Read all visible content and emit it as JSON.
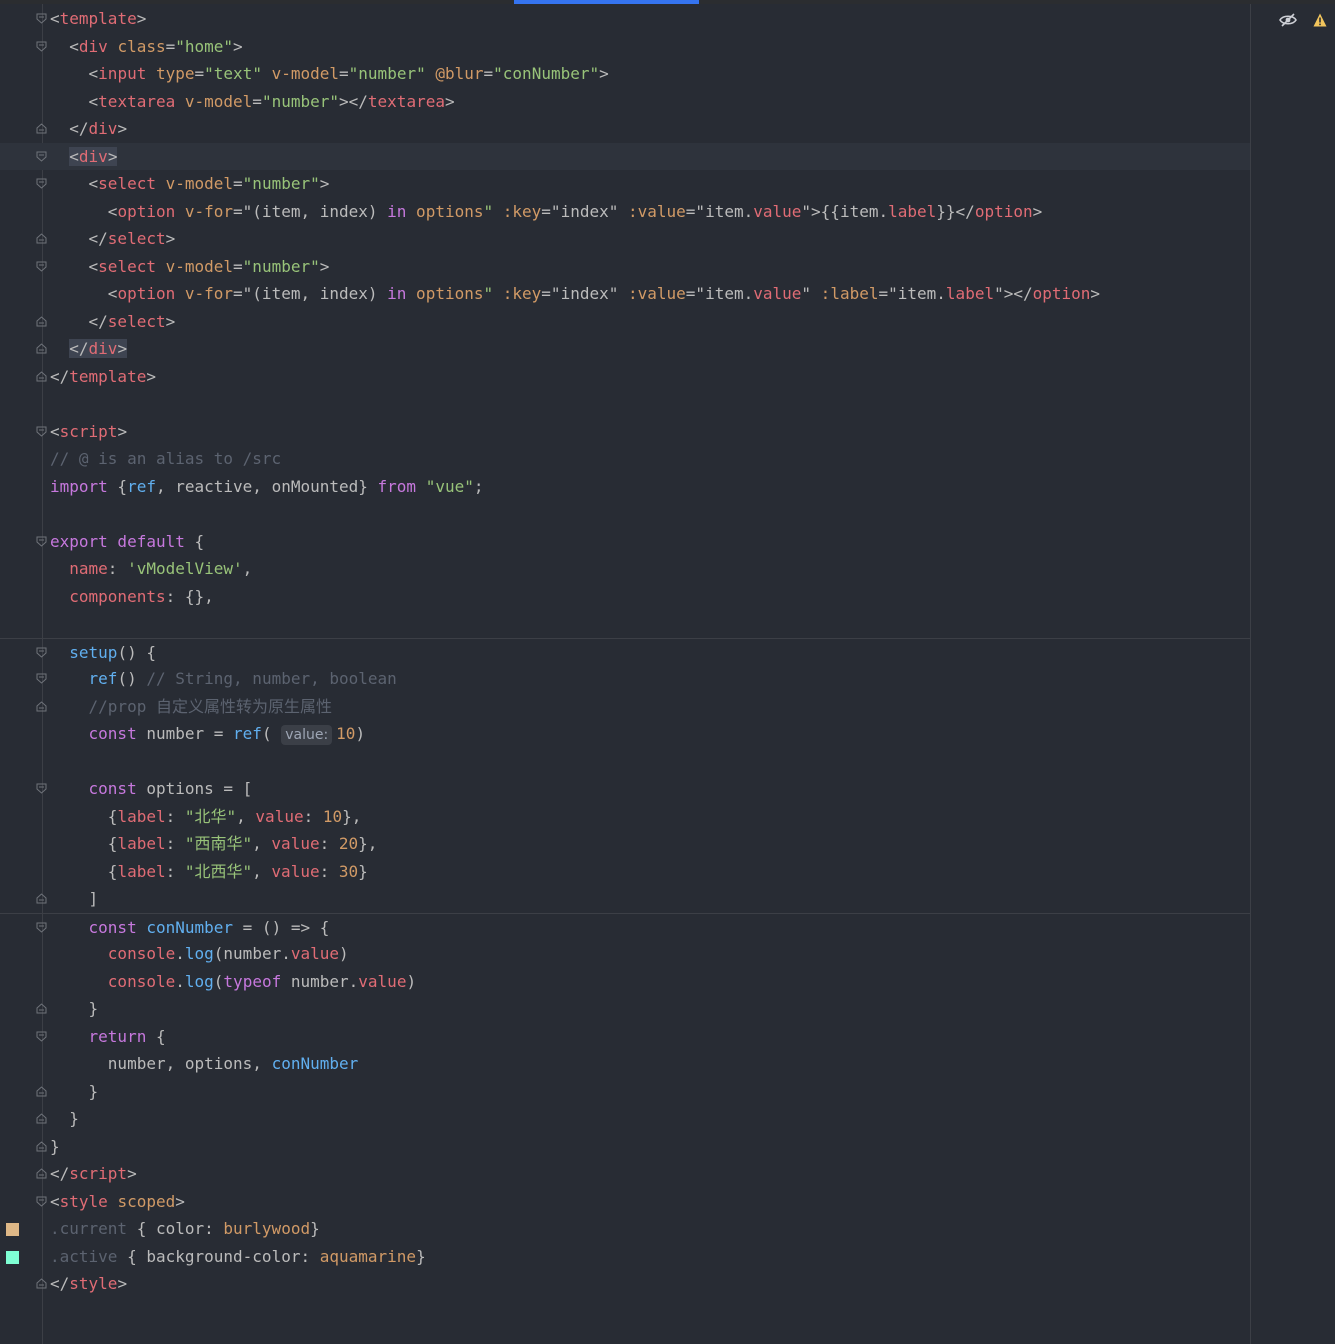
{
  "colors": {
    "swatch_burlywood": "#deb887",
    "swatch_aquamarine": "#7fffd4"
  },
  "lines": [
    {
      "fold": "open",
      "hl": false,
      "spans": [
        {
          "c": "p",
          "t": "<"
        },
        {
          "c": "t",
          "t": "template"
        },
        {
          "c": "p",
          "t": ">"
        }
      ]
    },
    {
      "fold": "open",
      "hl": false,
      "spans": [
        {
          "c": "p",
          "t": "  <"
        },
        {
          "c": "t",
          "t": "div"
        },
        {
          "c": "a",
          "t": " class"
        },
        {
          "c": "p",
          "t": "="
        },
        {
          "c": "s",
          "t": "\"home\""
        },
        {
          "c": "p",
          "t": ">"
        }
      ]
    },
    {
      "fold": "",
      "hl": false,
      "spans": [
        {
          "c": "p",
          "t": "    <"
        },
        {
          "c": "t",
          "t": "input"
        },
        {
          "c": "a",
          "t": " type"
        },
        {
          "c": "p",
          "t": "="
        },
        {
          "c": "s",
          "t": "\"text\""
        },
        {
          "c": "a",
          "t": " v-model"
        },
        {
          "c": "p",
          "t": "="
        },
        {
          "c": "s",
          "t": "\"number\""
        },
        {
          "c": "a",
          "t": " @blur"
        },
        {
          "c": "p",
          "t": "="
        },
        {
          "c": "s",
          "t": "\"conNumber\""
        },
        {
          "c": "p",
          "t": ">"
        }
      ]
    },
    {
      "fold": "",
      "hl": false,
      "spans": [
        {
          "c": "p",
          "t": "    <"
        },
        {
          "c": "t",
          "t": "textarea"
        },
        {
          "c": "a",
          "t": " v-model"
        },
        {
          "c": "p",
          "t": "="
        },
        {
          "c": "s",
          "t": "\"number\""
        },
        {
          "c": "p",
          "t": "></"
        },
        {
          "c": "t",
          "t": "textarea"
        },
        {
          "c": "p",
          "t": ">"
        }
      ]
    },
    {
      "fold": "close",
      "hl": false,
      "spans": [
        {
          "c": "p",
          "t": "  </"
        },
        {
          "c": "t",
          "t": "div"
        },
        {
          "c": "p",
          "t": ">"
        }
      ]
    },
    {
      "fold": "open",
      "hl": true,
      "spans": [
        {
          "c": "p",
          "t": "  "
        },
        {
          "c": "p hl",
          "t": "<"
        },
        {
          "c": "t hl",
          "t": "div"
        },
        {
          "c": "p hl",
          "t": ">"
        }
      ]
    },
    {
      "fold": "open",
      "hl": false,
      "spans": [
        {
          "c": "p",
          "t": "    <"
        },
        {
          "c": "t",
          "t": "select"
        },
        {
          "c": "a",
          "t": " v-model"
        },
        {
          "c": "p",
          "t": "="
        },
        {
          "c": "s",
          "t": "\"number\""
        },
        {
          "c": "p",
          "t": ">"
        }
      ]
    },
    {
      "fold": "",
      "hl": false,
      "spans": [
        {
          "c": "p",
          "t": "      <"
        },
        {
          "c": "t",
          "t": "option"
        },
        {
          "c": "a",
          "t": " v-for"
        },
        {
          "c": "p",
          "t": "=\"(item, index) "
        },
        {
          "c": "k",
          "t": "in"
        },
        {
          "c": "a",
          "t": " options"
        },
        {
          "c": "s",
          "t": "\""
        },
        {
          "c": "a",
          "t": " :key"
        },
        {
          "c": "p",
          "t": "=\"index\""
        },
        {
          "c": "a",
          "t": " :value"
        },
        {
          "c": "p",
          "t": "=\"item."
        },
        {
          "c": "t",
          "t": "value"
        },
        {
          "c": "p",
          "t": "\">{{item."
        },
        {
          "c": "t",
          "t": "label"
        },
        {
          "c": "p",
          "t": "}}</"
        },
        {
          "c": "t",
          "t": "option"
        },
        {
          "c": "p",
          "t": ">"
        }
      ]
    },
    {
      "fold": "close",
      "hl": false,
      "spans": [
        {
          "c": "p",
          "t": "    </"
        },
        {
          "c": "t",
          "t": "select"
        },
        {
          "c": "p",
          "t": ">"
        }
      ]
    },
    {
      "fold": "open",
      "hl": false,
      "spans": [
        {
          "c": "p",
          "t": "    <"
        },
        {
          "c": "t",
          "t": "select"
        },
        {
          "c": "a",
          "t": " v-model"
        },
        {
          "c": "p",
          "t": "="
        },
        {
          "c": "s",
          "t": "\"number\""
        },
        {
          "c": "p",
          "t": ">"
        }
      ]
    },
    {
      "fold": "",
      "hl": false,
      "spans": [
        {
          "c": "p",
          "t": "      <"
        },
        {
          "c": "t",
          "t": "option"
        },
        {
          "c": "a",
          "t": " v-for"
        },
        {
          "c": "p",
          "t": "=\"(item, index) "
        },
        {
          "c": "k",
          "t": "in"
        },
        {
          "c": "a",
          "t": " options"
        },
        {
          "c": "s",
          "t": "\""
        },
        {
          "c": "a",
          "t": " :key"
        },
        {
          "c": "p",
          "t": "=\"index\""
        },
        {
          "c": "a",
          "t": " :value"
        },
        {
          "c": "p",
          "t": "=\"item."
        },
        {
          "c": "t",
          "t": "value"
        },
        {
          "c": "p",
          "t": "\""
        },
        {
          "c": "a",
          "t": " :label"
        },
        {
          "c": "p",
          "t": "=\"item."
        },
        {
          "c": "t",
          "t": "label"
        },
        {
          "c": "p",
          "t": "\"></"
        },
        {
          "c": "t",
          "t": "option"
        },
        {
          "c": "p",
          "t": ">"
        }
      ]
    },
    {
      "fold": "close",
      "hl": false,
      "spans": [
        {
          "c": "p",
          "t": "    </"
        },
        {
          "c": "t",
          "t": "select"
        },
        {
          "c": "p",
          "t": ">"
        }
      ]
    },
    {
      "fold": "close",
      "hl": false,
      "spans": [
        {
          "c": "p",
          "t": "  "
        },
        {
          "c": "p hl",
          "t": "</"
        },
        {
          "c": "t hl",
          "t": "div"
        },
        {
          "c": "p hl",
          "t": ">"
        }
      ]
    },
    {
      "fold": "close",
      "hl": false,
      "spans": [
        {
          "c": "p",
          "t": "</"
        },
        {
          "c": "t",
          "t": "template"
        },
        {
          "c": "p",
          "t": ">"
        }
      ]
    },
    {
      "fold": "",
      "hl": false,
      "spans": []
    },
    {
      "fold": "open",
      "hl": false,
      "spans": [
        {
          "c": "p",
          "t": "<"
        },
        {
          "c": "t",
          "t": "script"
        },
        {
          "c": "p",
          "t": ">"
        }
      ]
    },
    {
      "fold": "",
      "hl": false,
      "spans": [
        {
          "c": "c",
          "t": "// @ is an alias to /src"
        }
      ]
    },
    {
      "fold": "",
      "hl": false,
      "spans": [
        {
          "c": "k",
          "t": "import"
        },
        {
          "c": "p",
          "t": " {"
        },
        {
          "c": "f",
          "t": "ref"
        },
        {
          "c": "p",
          "t": ", reactive, onMounted} "
        },
        {
          "c": "k",
          "t": "from"
        },
        {
          "c": "s",
          "t": " \"vue\""
        },
        {
          "c": "p",
          "t": ";"
        }
      ]
    },
    {
      "fold": "",
      "hl": false,
      "spans": []
    },
    {
      "fold": "open",
      "hl": false,
      "spans": [
        {
          "c": "k",
          "t": "export default"
        },
        {
          "c": "p",
          "t": " {"
        }
      ]
    },
    {
      "fold": "",
      "hl": false,
      "spans": [
        {
          "c": "t",
          "t": "  name"
        },
        {
          "c": "p",
          "t": ": "
        },
        {
          "c": "s",
          "t": "'vModelView'"
        },
        {
          "c": "p",
          "t": ","
        }
      ]
    },
    {
      "fold": "",
      "hl": false,
      "spans": [
        {
          "c": "t",
          "t": "  components"
        },
        {
          "c": "p",
          "t": ": {},"
        }
      ]
    },
    {
      "fold": "",
      "hl": false,
      "spans": []
    },
    {
      "fold": "open",
      "hl": false,
      "sep": true,
      "spans": [
        {
          "c": "f",
          "t": "  setup"
        },
        {
          "c": "p",
          "t": "() {"
        }
      ]
    },
    {
      "fold": "open",
      "hl": false,
      "spans": [
        {
          "c": "f",
          "t": "    ref"
        },
        {
          "c": "p",
          "t": "() "
        },
        {
          "c": "c",
          "t": "// String, number, boolean"
        }
      ]
    },
    {
      "fold": "close",
      "hl": false,
      "spans": [
        {
          "c": "c",
          "t": "    //prop 自定义属性转为原生属性"
        }
      ]
    },
    {
      "fold": "",
      "hl": false,
      "hint": "value:",
      "spans": [
        {
          "c": "k",
          "t": "    const"
        },
        {
          "c": "p",
          "t": " number = "
        },
        {
          "c": "f",
          "t": "ref"
        },
        {
          "c": "p",
          "t": "( "
        },
        {
          "c": "hint",
          "t": ""
        },
        {
          "c": "n",
          "t": "10"
        },
        {
          "c": "p",
          "t": ")"
        }
      ]
    },
    {
      "fold": "",
      "hl": false,
      "spans": []
    },
    {
      "fold": "open",
      "hl": false,
      "spans": [
        {
          "c": "k",
          "t": "    const"
        },
        {
          "c": "p",
          "t": " options = ["
        }
      ]
    },
    {
      "fold": "",
      "hl": false,
      "spans": [
        {
          "c": "p",
          "t": "      {"
        },
        {
          "c": "t",
          "t": "label"
        },
        {
          "c": "p",
          "t": ": "
        },
        {
          "c": "s",
          "t": "\"北华\""
        },
        {
          "c": "p",
          "t": ", "
        },
        {
          "c": "t",
          "t": "value"
        },
        {
          "c": "p",
          "t": ": "
        },
        {
          "c": "n",
          "t": "10"
        },
        {
          "c": "p",
          "t": "},"
        }
      ]
    },
    {
      "fold": "",
      "hl": false,
      "spans": [
        {
          "c": "p",
          "t": "      {"
        },
        {
          "c": "t",
          "t": "label"
        },
        {
          "c": "p",
          "t": ": "
        },
        {
          "c": "s",
          "t": "\"西南华\""
        },
        {
          "c": "p",
          "t": ", "
        },
        {
          "c": "t",
          "t": "value"
        },
        {
          "c": "p",
          "t": ": "
        },
        {
          "c": "n",
          "t": "20"
        },
        {
          "c": "p",
          "t": "},"
        }
      ]
    },
    {
      "fold": "",
      "hl": false,
      "spans": [
        {
          "c": "p",
          "t": "      {"
        },
        {
          "c": "t",
          "t": "label"
        },
        {
          "c": "p",
          "t": ": "
        },
        {
          "c": "s",
          "t": "\"北西华\""
        },
        {
          "c": "p",
          "t": ", "
        },
        {
          "c": "t",
          "t": "value"
        },
        {
          "c": "p",
          "t": ": "
        },
        {
          "c": "n",
          "t": "30"
        },
        {
          "c": "p",
          "t": "}"
        }
      ]
    },
    {
      "fold": "close",
      "hl": false,
      "spans": [
        {
          "c": "p",
          "t": "    ]"
        }
      ]
    },
    {
      "fold": "open",
      "hl": false,
      "sep": true,
      "spans": [
        {
          "c": "k",
          "t": "    const"
        },
        {
          "c": "f",
          "t": " conNumber"
        },
        {
          "c": "p",
          "t": " = () => {"
        }
      ]
    },
    {
      "fold": "",
      "hl": false,
      "spans": [
        {
          "c": "t",
          "t": "      console"
        },
        {
          "c": "p",
          "t": "."
        },
        {
          "c": "f",
          "t": "log"
        },
        {
          "c": "p",
          "t": "(number."
        },
        {
          "c": "t",
          "t": "value"
        },
        {
          "c": "p",
          "t": ")"
        }
      ]
    },
    {
      "fold": "",
      "hl": false,
      "spans": [
        {
          "c": "t",
          "t": "      console"
        },
        {
          "c": "p",
          "t": "."
        },
        {
          "c": "f",
          "t": "log"
        },
        {
          "c": "p",
          "t": "("
        },
        {
          "c": "k",
          "t": "typeof"
        },
        {
          "c": "p",
          "t": " number."
        },
        {
          "c": "t",
          "t": "value"
        },
        {
          "c": "p",
          "t": ")"
        }
      ]
    },
    {
      "fold": "close",
      "hl": false,
      "spans": [
        {
          "c": "p",
          "t": "    }"
        }
      ]
    },
    {
      "fold": "open",
      "hl": false,
      "spans": [
        {
          "c": "k",
          "t": "    return"
        },
        {
          "c": "p",
          "t": " {"
        }
      ]
    },
    {
      "fold": "",
      "hl": false,
      "spans": [
        {
          "c": "p",
          "t": "      number, options, "
        },
        {
          "c": "f",
          "t": "conNumber"
        }
      ]
    },
    {
      "fold": "close",
      "hl": false,
      "spans": [
        {
          "c": "p",
          "t": "    }"
        }
      ]
    },
    {
      "fold": "close",
      "hl": false,
      "spans": [
        {
          "c": "p",
          "t": "  }"
        }
      ]
    },
    {
      "fold": "close",
      "hl": false,
      "spans": [
        {
          "c": "p",
          "t": "}"
        }
      ]
    },
    {
      "fold": "close",
      "hl": false,
      "spans": [
        {
          "c": "p",
          "t": "</"
        },
        {
          "c": "t",
          "t": "script"
        },
        {
          "c": "p",
          "t": ">"
        }
      ]
    },
    {
      "fold": "open",
      "hl": false,
      "spans": [
        {
          "c": "p",
          "t": "<"
        },
        {
          "c": "t",
          "t": "style"
        },
        {
          "c": "a",
          "t": " scoped"
        },
        {
          "c": "p",
          "t": ">"
        }
      ]
    },
    {
      "fold": "",
      "hl": false,
      "swatch": "burlywood",
      "spans": [
        {
          "c": "c",
          "t": ".current"
        },
        {
          "c": "p",
          "t": " { color: "
        },
        {
          "c": "n",
          "t": "burlywood"
        },
        {
          "c": "p",
          "t": "}"
        }
      ]
    },
    {
      "fold": "",
      "hl": false,
      "swatch": "aquamarine",
      "spans": [
        {
          "c": "c",
          "t": ".active"
        },
        {
          "c": "p",
          "t": " { background-color: "
        },
        {
          "c": "n",
          "t": "aquamarine"
        },
        {
          "c": "p",
          "t": "}"
        }
      ]
    },
    {
      "fold": "close",
      "hl": false,
      "spans": [
        {
          "c": "p",
          "t": "</"
        },
        {
          "c": "t",
          "t": "style"
        },
        {
          "c": "p",
          "t": ">"
        }
      ]
    }
  ]
}
